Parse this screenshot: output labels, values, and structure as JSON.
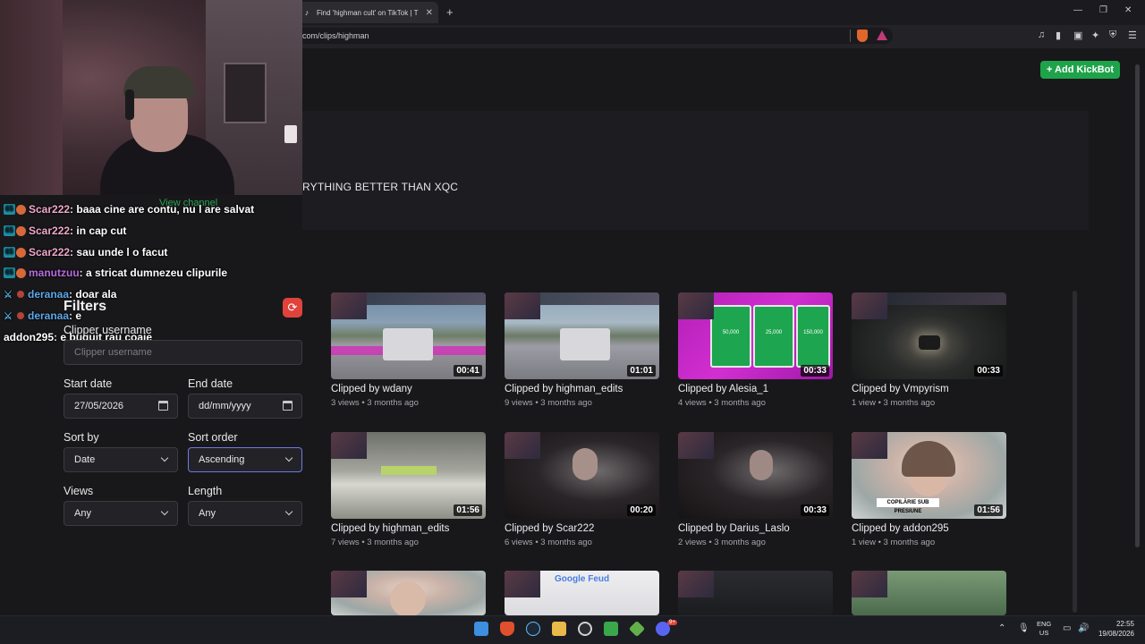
{
  "browser": {
    "tab_title": "Find 'highman cult' on TikTok | T",
    "tab_close": "✕",
    "new_tab": "+",
    "url": "com/clips/highman",
    "window_controls": {
      "minimize": "—",
      "restore": "❐",
      "close": "✕"
    }
  },
  "page": {
    "add_kickbot_label": "+ Add KickBot",
    "banner_text": "RYTHING BETTER THAN XQC",
    "view_channel_label": "View channel"
  },
  "chat": [
    {
      "user": "Scar222",
      "text": "baaa cine are contu, nu l are salvat",
      "color": "#f1a9c9",
      "badges": [
        "sub",
        "gift"
      ]
    },
    {
      "user": "Scar222",
      "text": "in cap cut",
      "color": "#f1a9c9",
      "badges": [
        "sub",
        "gift"
      ]
    },
    {
      "user": "Scar222",
      "text": "sau unde l o facut",
      "color": "#f1a9c9",
      "badges": [
        "sub",
        "gift"
      ]
    },
    {
      "user": "manutzuu",
      "text": "a stricat dumnezeu clipurile",
      "color": "#b96be0",
      "badges": [
        "sub",
        "gift"
      ]
    },
    {
      "user": "deranaa",
      "text": "doar ala",
      "color": "#5ea8e8",
      "badges": [
        "sword",
        "dot"
      ]
    },
    {
      "user": "deranaa",
      "text": "e",
      "color": "#5ea8e8",
      "badges": [
        "sword",
        "dot"
      ]
    },
    {
      "user": "addon295",
      "text": "e buguit rau coaie",
      "color": "#ffffff",
      "badges": []
    }
  ],
  "filters": {
    "title": "Filters",
    "reset_icon": "refresh-icon",
    "clipper_username_label": "Clipper username",
    "clipper_username_placeholder": "Clipper username",
    "start_date_label": "Start date",
    "start_date_value": "27/05/2026",
    "end_date_label": "End date",
    "end_date_placeholder": "dd/mm/yyyy",
    "sort_by_label": "Sort by",
    "sort_by_value": "Date",
    "sort_order_label": "Sort order",
    "sort_order_value": "Ascending",
    "views_label": "Views",
    "views_value": "Any",
    "length_label": "Length",
    "length_value": "Any"
  },
  "clips": [
    {
      "title": "Clipped by wdany",
      "meta": "3 views • 3 months ago",
      "duration": "00:41"
    },
    {
      "title": "Clipped by highman_edits",
      "meta": "9 views • 3 months ago",
      "duration": "01:01"
    },
    {
      "title": "Clipped by Alesia_1",
      "meta": "4 views • 3 months ago",
      "duration": "00:33"
    },
    {
      "title": "Clipped by Vmpyrism",
      "meta": "1 view • 3 months ago",
      "duration": "00:33"
    },
    {
      "title": "Clipped by highman_edits",
      "meta": "7 views • 3 months ago",
      "duration": "01:56"
    },
    {
      "title": "Clipped by Scar222",
      "meta": "6 views • 3 months ago",
      "duration": "00:20"
    },
    {
      "title": "Clipped by Darius_Laslo",
      "meta": "2 views • 3 months ago",
      "duration": "00:33"
    },
    {
      "title": "Clipped by addon295",
      "meta": "1 view • 3 months ago",
      "duration": "01:56"
    }
  ],
  "thumb_text": {
    "slot_values": [
      "50,000",
      "25,000",
      "150,000"
    ],
    "caption": "COPILĂRIE SUB PRESIUNE",
    "google": "Google Feud"
  },
  "taskbar": {
    "lang_top": "ENG",
    "lang_bottom": "US",
    "time": "22:55",
    "date": "19/08/2026",
    "discord_badge": "9+"
  },
  "colors": {
    "accent_green": "#1fa34a",
    "reset_red": "#e0433b",
    "focus_border": "#6d7ae0"
  }
}
